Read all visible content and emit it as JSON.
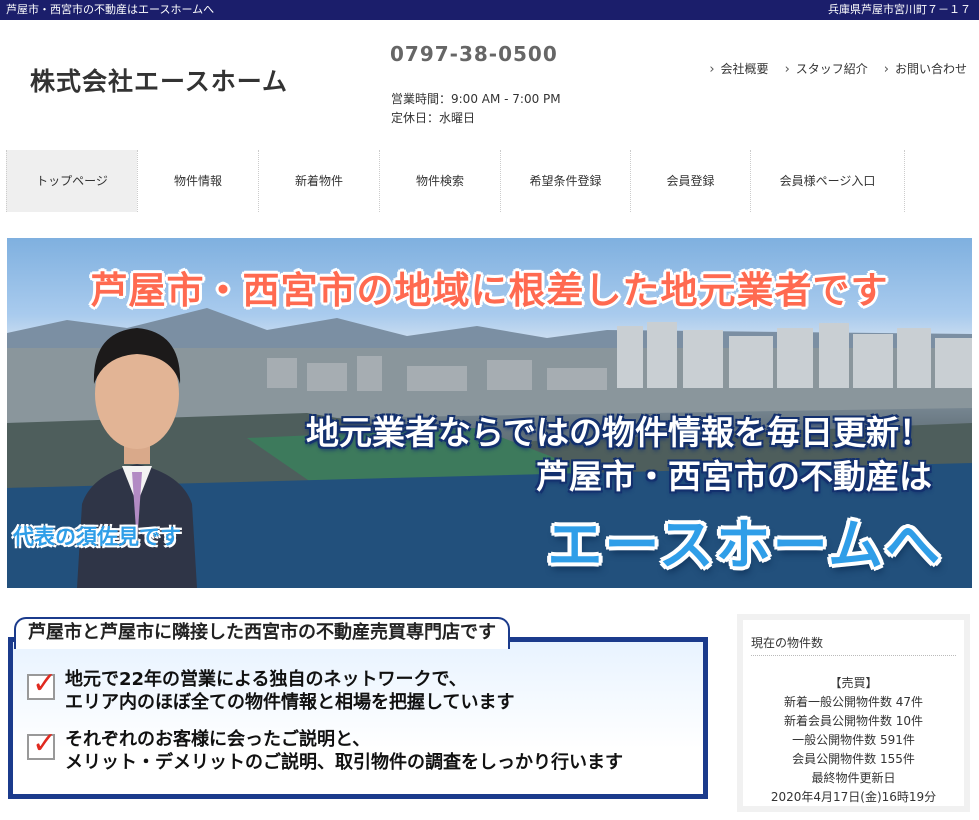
{
  "topbar": {
    "left": "芦屋市・西宮市の不動産はエースホームへ",
    "right": "兵庫県芦屋市宮川町７－１７"
  },
  "header": {
    "company": "株式会社エースホーム",
    "phone": "0797-38-0500",
    "hours": "営業時間：9:00 AM - 7:00 PM",
    "closed": "定休日：水曜日",
    "links": [
      "会社概要",
      "スタッフ紹介",
      "お問い合わせ"
    ]
  },
  "nav": [
    "トップページ",
    "物件情報",
    "新着物件",
    "物件検索",
    "希望条件登録",
    "会員登録",
    "会員様ページ入口"
  ],
  "hero": {
    "headline": "芦屋市・西宮市の地域に根差した地元業者です",
    "line1": "地元業者ならではの物件情報を毎日更新！",
    "line2": "芦屋市・西宮市の不動産は",
    "line3": "エースホームへ",
    "rep": "代表の須佐見です"
  },
  "feature": {
    "title": "芦屋市と芦屋市に隣接した西宮市の不動産売買専門店です",
    "points": [
      [
        "地元で22年の営業による独自のネットワークで、",
        "エリア内のほぼ全ての物件情報と相場を把握しています"
      ],
      [
        "それぞれのお客様に会ったご説明と、",
        "メリット・デメリットのご説明、取引物件の調査をしっかり行います"
      ]
    ]
  },
  "sidebar": {
    "title": "現在の物件数",
    "lines": [
      "【売買】",
      "新着一般公開物件数 47件",
      "新着会員公開物件数 10件",
      "一般公開物件数 591件",
      "会員公開物件数 155件",
      "最終物件更新日",
      "2020年4月17日(金)16時19分"
    ]
  },
  "colors": {
    "topbar": "#1b1e6b",
    "frame": "#1b3b8c",
    "accent_red": "#ff6a50",
    "accent_blue": "#2f9ee8"
  }
}
